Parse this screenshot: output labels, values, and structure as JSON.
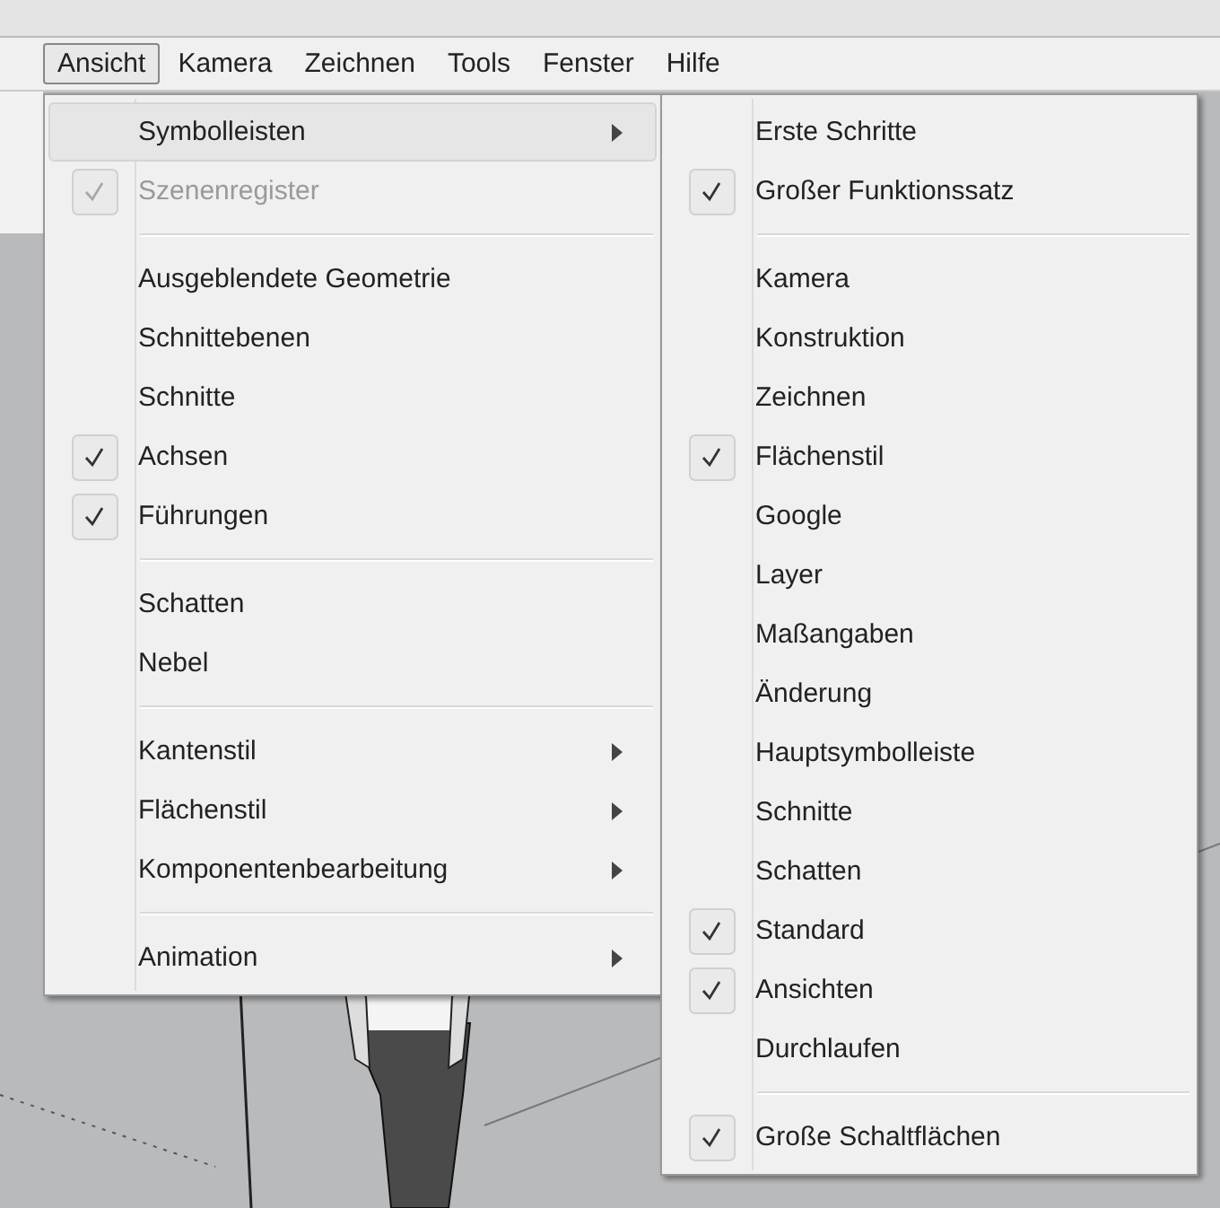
{
  "menubar": [
    {
      "label": "Ansicht",
      "selected": true
    },
    {
      "label": "Kamera",
      "selected": false
    },
    {
      "label": "Zeichnen",
      "selected": false
    },
    {
      "label": "Tools",
      "selected": false
    },
    {
      "label": "Fenster",
      "selected": false
    },
    {
      "label": "Hilfe",
      "selected": false
    }
  ],
  "menu": {
    "sections": [
      [
        {
          "label": "Symbolleisten",
          "checked": false,
          "disabled": false,
          "submenu": true,
          "selected": true
        },
        {
          "label": "Szenenregister",
          "checked": true,
          "disabled": true,
          "submenu": false,
          "selected": false
        }
      ],
      [
        {
          "label": "Ausgeblendete Geometrie",
          "checked": false,
          "disabled": false,
          "submenu": false,
          "selected": false
        },
        {
          "label": "Schnittebenen",
          "checked": false,
          "disabled": false,
          "submenu": false,
          "selected": false
        },
        {
          "label": "Schnitte",
          "checked": false,
          "disabled": false,
          "submenu": false,
          "selected": false
        },
        {
          "label": "Achsen",
          "checked": true,
          "disabled": false,
          "submenu": false,
          "selected": false
        },
        {
          "label": "Führungen",
          "checked": true,
          "disabled": false,
          "submenu": false,
          "selected": false
        }
      ],
      [
        {
          "label": "Schatten",
          "checked": false,
          "disabled": false,
          "submenu": false,
          "selected": false
        },
        {
          "label": "Nebel",
          "checked": false,
          "disabled": false,
          "submenu": false,
          "selected": false
        }
      ],
      [
        {
          "label": "Kantenstil",
          "checked": false,
          "disabled": false,
          "submenu": true,
          "selected": false
        },
        {
          "label": "Flächenstil",
          "checked": false,
          "disabled": false,
          "submenu": true,
          "selected": false
        },
        {
          "label": "Komponentenbearbeitung",
          "checked": false,
          "disabled": false,
          "submenu": true,
          "selected": false
        }
      ],
      [
        {
          "label": "Animation",
          "checked": false,
          "disabled": false,
          "submenu": true,
          "selected": false
        }
      ]
    ]
  },
  "submenu": {
    "sections": [
      [
        {
          "label": "Erste Schritte",
          "checked": false
        },
        {
          "label": "Großer Funktionssatz",
          "checked": true
        }
      ],
      [
        {
          "label": "Kamera",
          "checked": false
        },
        {
          "label": "Konstruktion",
          "checked": false
        },
        {
          "label": "Zeichnen",
          "checked": false
        },
        {
          "label": "Flächenstil",
          "checked": true
        },
        {
          "label": "Google",
          "checked": false
        },
        {
          "label": "Layer",
          "checked": false
        },
        {
          "label": "Maßangaben",
          "checked": false
        },
        {
          "label": "Änderung",
          "checked": false
        },
        {
          "label": "Hauptsymbolleiste",
          "checked": false
        },
        {
          "label": "Schnitte",
          "checked": false
        },
        {
          "label": "Schatten",
          "checked": false
        },
        {
          "label": "Standard",
          "checked": true
        },
        {
          "label": "Ansichten",
          "checked": true
        },
        {
          "label": "Durchlaufen",
          "checked": false
        }
      ],
      [
        {
          "label": "Große Schaltflächen",
          "checked": true
        }
      ]
    ]
  }
}
